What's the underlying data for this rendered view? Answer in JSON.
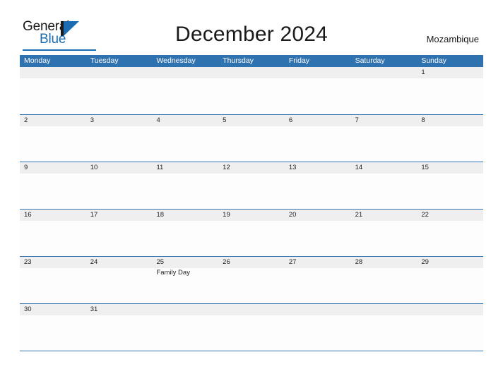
{
  "brand": {
    "name_part1": "General",
    "name_part2": "Blue",
    "logo_icon": "triangle-flag-icon"
  },
  "header": {
    "title": "December 2024",
    "region": "Mozambique"
  },
  "calendar": {
    "month": "December",
    "year": "2024",
    "weekdays": [
      "Monday",
      "Tuesday",
      "Wednesday",
      "Thursday",
      "Friday",
      "Saturday",
      "Sunday"
    ],
    "colors": {
      "header_blue": "#2f72b0",
      "number_band_gray": "#efefef",
      "grid_line": "#2f72b0",
      "brand_blue": "#1b6cb0",
      "text": "#1f1f1f"
    },
    "weeks": [
      {
        "days": [
          {
            "number": "",
            "events": []
          },
          {
            "number": "",
            "events": []
          },
          {
            "number": "",
            "events": []
          },
          {
            "number": "",
            "events": []
          },
          {
            "number": "",
            "events": []
          },
          {
            "number": "",
            "events": []
          },
          {
            "number": "1",
            "events": []
          }
        ]
      },
      {
        "days": [
          {
            "number": "2",
            "events": []
          },
          {
            "number": "3",
            "events": []
          },
          {
            "number": "4",
            "events": []
          },
          {
            "number": "5",
            "events": []
          },
          {
            "number": "6",
            "events": []
          },
          {
            "number": "7",
            "events": []
          },
          {
            "number": "8",
            "events": []
          }
        ]
      },
      {
        "days": [
          {
            "number": "9",
            "events": []
          },
          {
            "number": "10",
            "events": []
          },
          {
            "number": "11",
            "events": []
          },
          {
            "number": "12",
            "events": []
          },
          {
            "number": "13",
            "events": []
          },
          {
            "number": "14",
            "events": []
          },
          {
            "number": "15",
            "events": []
          }
        ]
      },
      {
        "days": [
          {
            "number": "16",
            "events": []
          },
          {
            "number": "17",
            "events": []
          },
          {
            "number": "18",
            "events": []
          },
          {
            "number": "19",
            "events": []
          },
          {
            "number": "20",
            "events": []
          },
          {
            "number": "21",
            "events": []
          },
          {
            "number": "22",
            "events": []
          }
        ]
      },
      {
        "days": [
          {
            "number": "23",
            "events": []
          },
          {
            "number": "24",
            "events": []
          },
          {
            "number": "25",
            "events": [
              "Family Day"
            ]
          },
          {
            "number": "26",
            "events": []
          },
          {
            "number": "27",
            "events": []
          },
          {
            "number": "28",
            "events": []
          },
          {
            "number": "29",
            "events": []
          }
        ]
      },
      {
        "days": [
          {
            "number": "30",
            "events": []
          },
          {
            "number": "31",
            "events": []
          },
          {
            "number": "",
            "events": []
          },
          {
            "number": "",
            "events": []
          },
          {
            "number": "",
            "events": []
          },
          {
            "number": "",
            "events": []
          },
          {
            "number": "",
            "events": []
          }
        ]
      }
    ]
  }
}
